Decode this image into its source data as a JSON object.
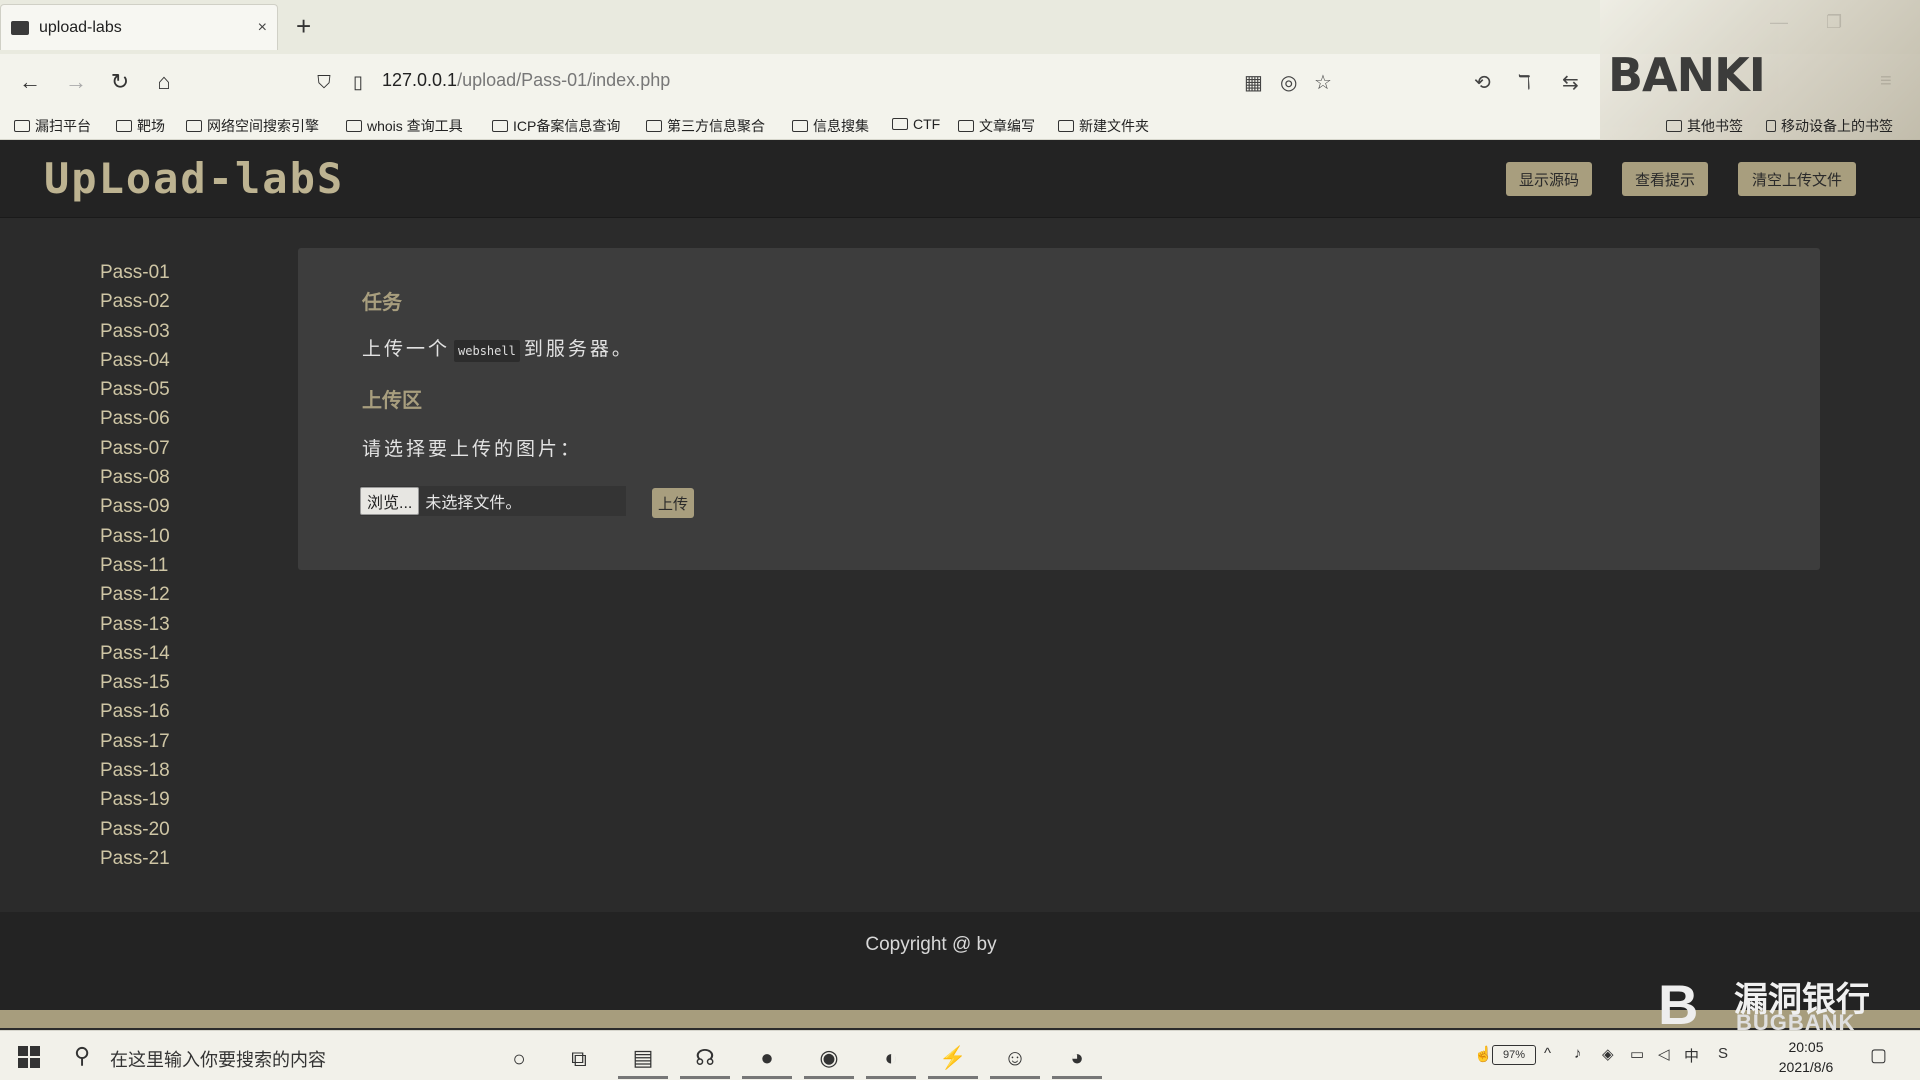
{
  "browser": {
    "tab_title": "upload-labs",
    "tab_close": "×",
    "new_tab": "+",
    "url_host": "127.0.0.1",
    "url_path": "/upload/Pass-01/index.php",
    "bookmarks": [
      "漏扫平台",
      "靶场",
      "网络空间搜索引擎",
      "whois 查询工具",
      "ICP备案信息查询",
      "第三方信息聚合",
      "信息搜集",
      "CTF",
      "文章编写",
      "新建文件夹"
    ],
    "bookmarks_right": [
      "其他书签",
      "移动设备上的书签"
    ]
  },
  "watermark": {
    "text": "BANKI"
  },
  "header": {
    "logo": "UpLoad-labS",
    "buttons": [
      "显示源码",
      "查看提示",
      "清空上传文件"
    ]
  },
  "sidebar": {
    "items": [
      "Pass-01",
      "Pass-02",
      "Pass-03",
      "Pass-04",
      "Pass-05",
      "Pass-06",
      "Pass-07",
      "Pass-08",
      "Pass-09",
      "Pass-10",
      "Pass-11",
      "Pass-12",
      "Pass-13",
      "Pass-14",
      "Pass-15",
      "Pass-16",
      "Pass-17",
      "Pass-18",
      "Pass-19",
      "Pass-20",
      "Pass-21"
    ]
  },
  "main": {
    "task_title": "任务",
    "task_text_before": "上传一个",
    "task_code": "webshell",
    "task_text_after": "到服务器。",
    "upload_title": "上传区",
    "upload_prompt": "请选择要上传的图片：",
    "browse_label": "浏览...",
    "file_status": "未选择文件。",
    "upload_button": "上传"
  },
  "footer": {
    "copyright": "Copyright @  by"
  },
  "bugbank": {
    "logo": "B",
    "name": "漏洞银行",
    "en": "BUGBANK"
  },
  "taskbar": {
    "search_placeholder": "在这里输入你要搜索的内容",
    "battery": "97%",
    "time": "20:05",
    "date": "2021/8/6"
  }
}
